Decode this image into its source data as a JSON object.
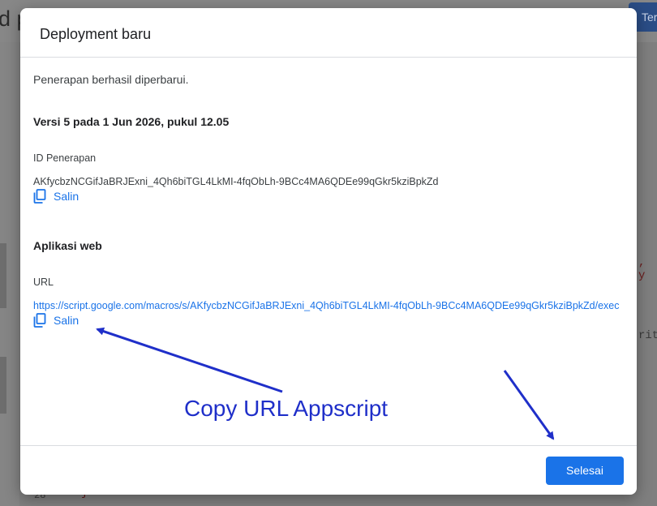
{
  "background": {
    "title_fragment": "d p",
    "button_fragment": "Ter",
    "line_number": "28",
    "brace": "}",
    "code_fragment_1": ", y",
    "code_fragment_2": "rith"
  },
  "dialog": {
    "title": "Deployment baru",
    "message": "Penerapan berhasil diperbarui.",
    "version": "Versi 5 pada 1 Jun 2026, pukul 12.05",
    "deployment_id": {
      "label": "ID Penerapan",
      "value": "AKfycbzNCGifJaBRJExni_4Qh6biTGL4LkMI-4fqObLh-9BCc4MA6QDEe99qGkr5kziBpkZd",
      "copy_label": "Salin",
      "copy_icon": "copy-icon"
    },
    "web_app": {
      "section_title": "Aplikasi web",
      "url_label": "URL",
      "url_value": "https://script.google.com/macros/s/AKfycbzNCGifJaBRJExni_4Qh6biTGL4LkMI-4fqObLh-9BCc4MA6QDEe99qGkr5kziBpkZd/exec",
      "copy_label": "Salin",
      "copy_icon": "copy-icon"
    },
    "done_label": "Selesai"
  },
  "annotation": {
    "text": "Copy URL Appscript",
    "color": "#1f2fc9"
  },
  "colors": {
    "accent": "#1a73e8",
    "title_text": "#202124",
    "body_text": "#3c4043",
    "divider": "#dadce0"
  }
}
